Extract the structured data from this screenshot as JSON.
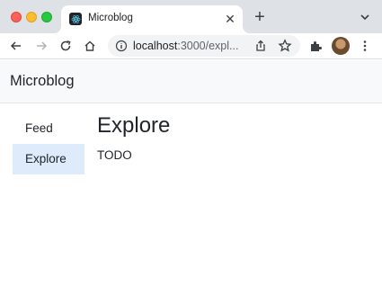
{
  "browser": {
    "tab": {
      "title": "Microblog",
      "favicon": "react-icon"
    },
    "toolbar": {
      "url_host": "localhost",
      "url_rest": ":3000/expl...",
      "icons": [
        "back-icon",
        "forward-icon",
        "reload-icon",
        "home-icon",
        "info-icon",
        "share-icon",
        "star-icon",
        "extensions-icon",
        "more-icon"
      ]
    },
    "colors": {
      "tabstrip": "#dee1e6",
      "omnibox": "#f1f3f4"
    }
  },
  "app": {
    "brand": "Microblog",
    "sidebar": {
      "items": [
        {
          "label": "Feed",
          "active": false
        },
        {
          "label": "Explore",
          "active": true
        }
      ]
    },
    "main": {
      "title": "Explore",
      "body": "TODO"
    },
    "colors": {
      "navbar_bg": "#f8f9fa",
      "active_item_bg": "#ddebfb"
    }
  }
}
